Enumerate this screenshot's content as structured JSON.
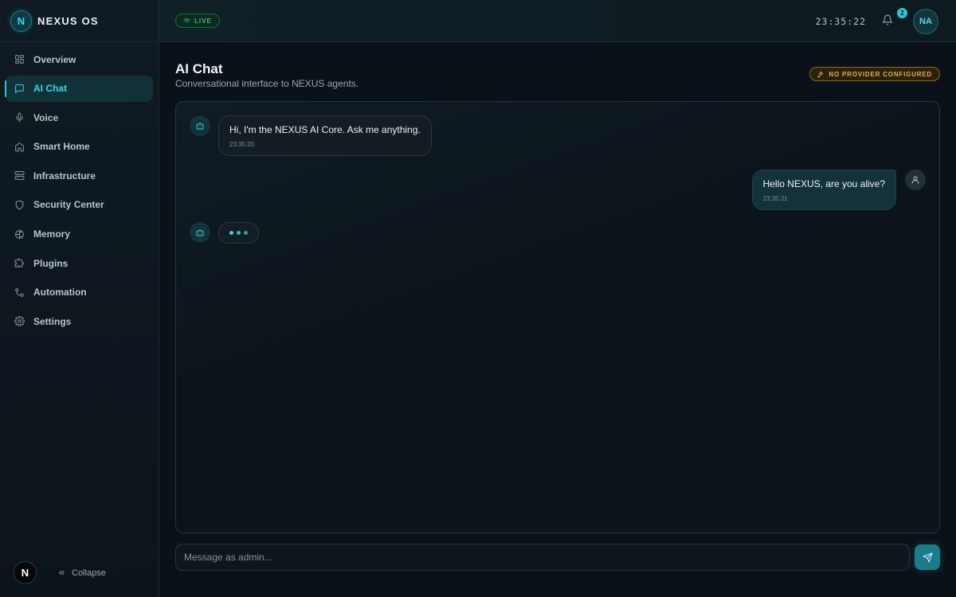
{
  "brand": {
    "logo_letter": "N",
    "name": "NEXUS OS"
  },
  "sidebar": {
    "items": [
      {
        "label": "Overview",
        "icon": "grid-icon",
        "active": false
      },
      {
        "label": "AI Chat",
        "icon": "chat-icon",
        "active": true
      },
      {
        "label": "Voice",
        "icon": "mic-icon",
        "active": false
      },
      {
        "label": "Smart Home",
        "icon": "home-icon",
        "active": false
      },
      {
        "label": "Infrastructure",
        "icon": "server-icon",
        "active": false
      },
      {
        "label": "Security Center",
        "icon": "shield-icon",
        "active": false
      },
      {
        "label": "Memory",
        "icon": "brain-icon",
        "active": false
      },
      {
        "label": "Plugins",
        "icon": "puzzle-icon",
        "active": false
      },
      {
        "label": "Automation",
        "icon": "workflow-icon",
        "active": false
      },
      {
        "label": "Settings",
        "icon": "gear-icon",
        "active": false
      }
    ],
    "footer_logo": "N",
    "collapse_label": "Collapse"
  },
  "topbar": {
    "live_label": "LIVE",
    "clock": "23:35:22",
    "notification_count": "2",
    "avatar_initials": "NA"
  },
  "page": {
    "title": "AI Chat",
    "subtitle": "Conversational interface to NEXUS agents.",
    "provider_status": "NO PROVIDER CONFIGURED"
  },
  "chat": {
    "messages": [
      {
        "role": "bot",
        "text": "Hi, I'm the NEXUS AI Core. Ask me anything.",
        "time": "23:35:20"
      },
      {
        "role": "user",
        "text": "Hello NEXUS, are you alive?",
        "time": "23:35:21"
      }
    ],
    "typing": true
  },
  "composer": {
    "placeholder": "Message as admin..."
  },
  "colors": {
    "accent": "#2fc6d8",
    "live": "#35c27a",
    "warning": "#e2b244",
    "background": "#0b1118"
  }
}
